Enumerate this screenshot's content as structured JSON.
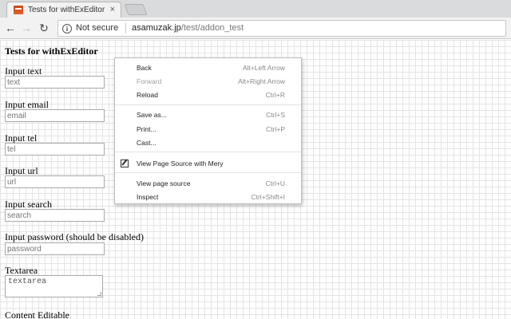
{
  "browser": {
    "tab": {
      "title": "Tests for withExEditor",
      "close_glyph": "×",
      "favicon": "withexeditor-icon"
    },
    "nav": {
      "back_glyph": "←",
      "forward_glyph": "→",
      "reload_glyph": "↻"
    },
    "omnibox": {
      "security_glyph": "i",
      "security_label": "Not secure",
      "url_host": "asamuzak.jp",
      "url_path": "/test/addon_test"
    }
  },
  "page": {
    "title": "Tests for withExEditor",
    "fields": [
      {
        "label": "Input text",
        "placeholder": "text"
      },
      {
        "label": "Input email",
        "placeholder": "email"
      },
      {
        "label": "Input tel",
        "placeholder": "tel"
      },
      {
        "label": "Input url",
        "placeholder": "url"
      },
      {
        "label": "Input search",
        "placeholder": "search"
      },
      {
        "label": "Input password (should be disabled)",
        "placeholder": "password"
      }
    ],
    "textarea": {
      "label": "Textarea",
      "placeholder": "textarea"
    },
    "content_editable": {
      "label": "Content Editable"
    }
  },
  "context_menu": {
    "items": [
      {
        "label": "Back",
        "shortcut": "Alt+Left Arrow"
      },
      {
        "label": "Forward",
        "shortcut": "Alt+Right Arrow",
        "disabled": true
      },
      {
        "label": "Reload",
        "shortcut": "Ctrl+R"
      },
      {
        "label": "Save as...",
        "shortcut": "Ctrl+S"
      },
      {
        "label": "Print...",
        "shortcut": "Ctrl+P"
      },
      {
        "label": "Cast...",
        "shortcut": ""
      },
      {
        "label": "View Page Source with Mery",
        "shortcut": "",
        "icon": "edit-icon"
      },
      {
        "label": "View page source",
        "shortcut": "Ctrl+U"
      },
      {
        "label": "Inspect",
        "shortcut": "Ctrl+Shift+I"
      }
    ]
  }
}
